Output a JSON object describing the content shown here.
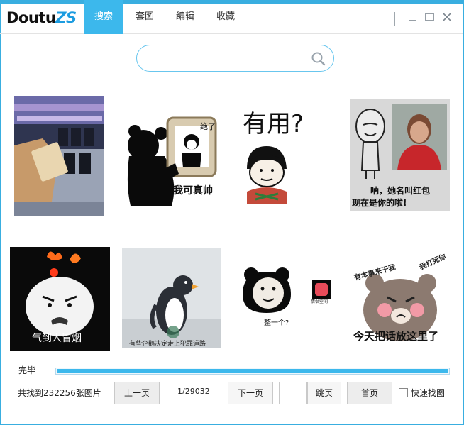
{
  "app": {
    "logo_main": "Doutu",
    "logo_suffix": "ZS",
    "tabs": [
      {
        "label": "搜索",
        "active": true
      },
      {
        "label": "套图",
        "active": false
      },
      {
        "label": "编辑",
        "active": false
      },
      {
        "label": "收藏",
        "active": false
      }
    ],
    "accent_color": "#3cb8ec",
    "window_controls": [
      "minimize-icon",
      "maximize-icon",
      "close-icon"
    ]
  },
  "search": {
    "value": "",
    "placeholder": "",
    "icon": "search-icon"
  },
  "results": {
    "tiles": [
      {
        "name": "meme-hand-phone",
        "caption": ""
      },
      {
        "name": "meme-panda-mirror",
        "caption": "我可真帅",
        "caption2": "绝了"
      },
      {
        "name": "meme-useful",
        "caption": "有用?"
      },
      {
        "name": "meme-red-bag",
        "caption": "呐，她名叫红包",
        "caption2": "现在是你的啦!"
      },
      {
        "name": "meme-angry-smoke",
        "caption": "气到人冒烟"
      },
      {
        "name": "meme-penguin",
        "caption": "有些企鹅决定走上犯罪道路"
      },
      {
        "name": "meme-panda-one",
        "caption": "整一个?",
        "caption2": "情侣空间"
      },
      {
        "name": "meme-bear-talk",
        "caption": "今天把话放这里了",
        "caption2": "有本事来干我",
        "caption3": "我打死你"
      }
    ]
  },
  "footer": {
    "status": "完毕",
    "progress": 1.0,
    "found_text": "共找到232256张图片",
    "prev_label": "上一页",
    "page_info": "1/29032",
    "next_label": "下一页",
    "jump_value": "",
    "jump_label": "跳页",
    "home_label": "首页",
    "quick_label": "快速找图",
    "quick_checked": false
  }
}
